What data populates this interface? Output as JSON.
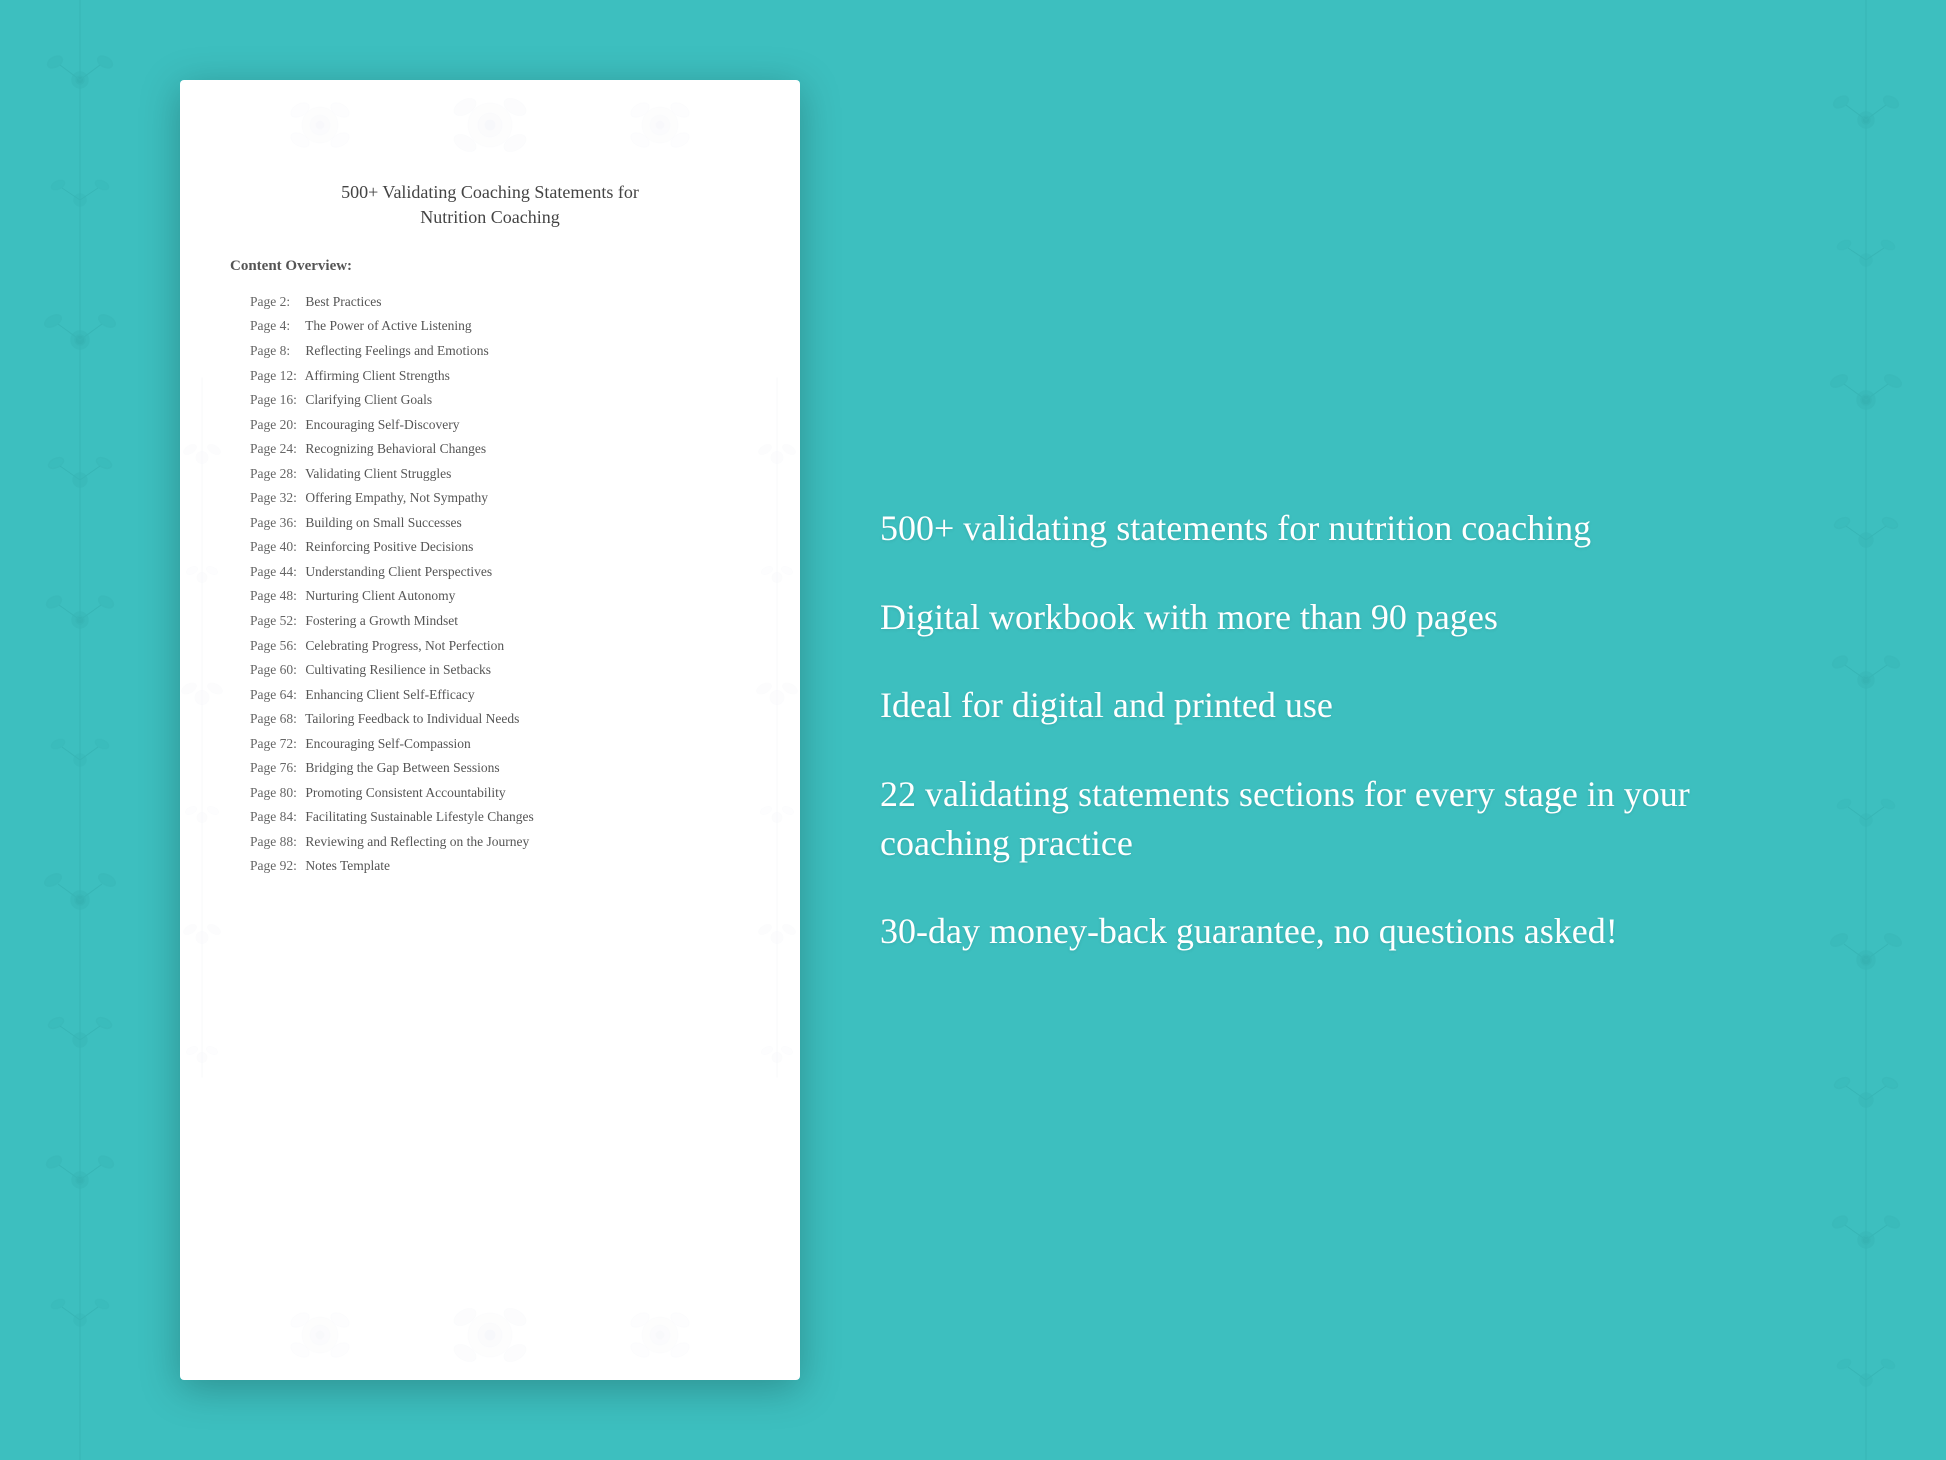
{
  "background_color": "#3dbfbf",
  "document": {
    "title_line1": "500+ Validating Coaching Statements for",
    "title_line2": "Nutrition Coaching",
    "content_overview_label": "Content Overview:",
    "toc_items": [
      {
        "page": "Page  2:",
        "title": "Best Practices"
      },
      {
        "page": "Page  4:",
        "title": "The Power of Active Listening"
      },
      {
        "page": "Page  8:",
        "title": "Reflecting Feelings and Emotions"
      },
      {
        "page": "Page 12:",
        "title": "Affirming Client Strengths"
      },
      {
        "page": "Page 16:",
        "title": "Clarifying Client Goals"
      },
      {
        "page": "Page 20:",
        "title": "Encouraging Self-Discovery"
      },
      {
        "page": "Page 24:",
        "title": "Recognizing Behavioral Changes"
      },
      {
        "page": "Page 28:",
        "title": "Validating Client Struggles"
      },
      {
        "page": "Page 32:",
        "title": "Offering Empathy, Not Sympathy"
      },
      {
        "page": "Page 36:",
        "title": "Building on Small Successes"
      },
      {
        "page": "Page 40:",
        "title": "Reinforcing Positive Decisions"
      },
      {
        "page": "Page 44:",
        "title": "Understanding Client Perspectives"
      },
      {
        "page": "Page 48:",
        "title": "Nurturing Client Autonomy"
      },
      {
        "page": "Page 52:",
        "title": "Fostering a Growth Mindset"
      },
      {
        "page": "Page 56:",
        "title": "Celebrating Progress, Not Perfection"
      },
      {
        "page": "Page 60:",
        "title": "Cultivating Resilience in Setbacks"
      },
      {
        "page": "Page 64:",
        "title": "Enhancing Client Self-Efficacy"
      },
      {
        "page": "Page 68:",
        "title": "Tailoring Feedback to Individual Needs"
      },
      {
        "page": "Page 72:",
        "title": "Encouraging Self-Compassion"
      },
      {
        "page": "Page 76:",
        "title": "Bridging the Gap Between Sessions"
      },
      {
        "page": "Page 80:",
        "title": "Promoting Consistent Accountability"
      },
      {
        "page": "Page 84:",
        "title": "Facilitating Sustainable Lifestyle Changes"
      },
      {
        "page": "Page 88:",
        "title": "Reviewing and Reflecting on the Journey"
      },
      {
        "page": "Page 92:",
        "title": "Notes Template"
      }
    ]
  },
  "features": [
    "500+ validating statements for nutrition coaching",
    "Digital workbook with more than 90 pages",
    "Ideal for digital and printed use",
    "22 validating statements sections for every stage in your coaching practice",
    "30-day money-back guarantee, no questions asked!"
  ]
}
